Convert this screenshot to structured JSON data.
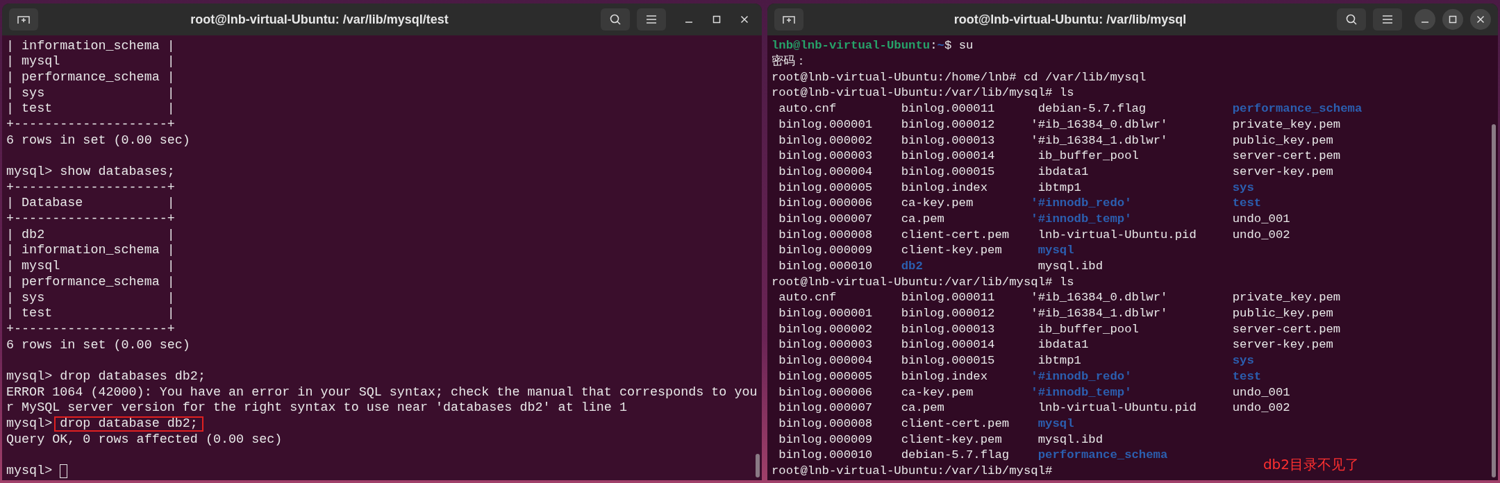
{
  "windows": [
    {
      "title": "root@lnb-virtual-Ubuntu: /var/lib/mysql/test",
      "focused": false,
      "lines": [
        {
          "kind": "text",
          "text": "| information_schema |"
        },
        {
          "kind": "text",
          "text": "| mysql              |"
        },
        {
          "kind": "text",
          "text": "| performance_schema |"
        },
        {
          "kind": "text",
          "text": "| sys                |"
        },
        {
          "kind": "text",
          "text": "| test               |"
        },
        {
          "kind": "text",
          "text": "+--------------------+"
        },
        {
          "kind": "text",
          "text": "6 rows in set (0.00 sec)"
        },
        {
          "kind": "blank"
        },
        {
          "kind": "command",
          "prompt": "mysql>",
          "command": "show databases;",
          "highlighted": false
        },
        {
          "kind": "text",
          "text": "+--------------------+"
        },
        {
          "kind": "text",
          "text": "| Database           |"
        },
        {
          "kind": "text",
          "text": "+--------------------+"
        },
        {
          "kind": "text",
          "text": "| db2                |"
        },
        {
          "kind": "text",
          "text": "| information_schema |"
        },
        {
          "kind": "text",
          "text": "| mysql              |"
        },
        {
          "kind": "text",
          "text": "| performance_schema |"
        },
        {
          "kind": "text",
          "text": "| sys                |"
        },
        {
          "kind": "text",
          "text": "| test               |"
        },
        {
          "kind": "text",
          "text": "+--------------------+"
        },
        {
          "kind": "text",
          "text": "6 rows in set (0.00 sec)"
        },
        {
          "kind": "blank"
        },
        {
          "kind": "command",
          "prompt": "mysql>",
          "command": "drop databases db2;",
          "highlighted": false
        },
        {
          "kind": "text",
          "text": "ERROR 1064 (42000): You have an error in your SQL syntax; check the manual that corresponds to you"
        },
        {
          "kind": "text",
          "text": "r MySQL server version for the right syntax to use near 'databases db2' at line 1"
        },
        {
          "kind": "command",
          "prompt": "mysql>",
          "command": "drop database db2;",
          "highlighted": true
        },
        {
          "kind": "text",
          "text": "Query OK, 0 rows affected (0.00 sec)"
        },
        {
          "kind": "blank"
        },
        {
          "kind": "cursor",
          "prompt": "mysql>"
        }
      ]
    },
    {
      "title": "root@lnb-virtual-Ubuntu: /var/lib/mysql",
      "focused": true,
      "note": "db2目录不见了",
      "lines": [
        {
          "kind": "user_prompt",
          "user": "lnb@lnb-virtual-Ubuntu",
          "sep": ":",
          "path": "~",
          "command": "$ su"
        },
        {
          "kind": "text",
          "text": "密码："
        },
        {
          "kind": "text",
          "text": "root@lnb-virtual-Ubuntu:/home/lnb# cd /var/lib/mysql"
        },
        {
          "kind": "text",
          "text": "root@lnb-virtual-Ubuntu:/var/lib/mysql# ls"
        },
        {
          "kind": "ls",
          "cells": [
            {
              "text": "auto.cnf",
              "kind": "file"
            },
            {
              "text": "binlog.000011",
              "kind": "file"
            },
            {
              "text": "debian-5.7.flag",
              "kind": "file"
            },
            {
              "text": "performance_schema",
              "kind": "dir"
            }
          ]
        },
        {
          "kind": "ls",
          "cells": [
            {
              "text": "binlog.000001",
              "kind": "file"
            },
            {
              "text": "binlog.000012",
              "kind": "file"
            },
            {
              "text": "'#ib_16384_0.dblwr'",
              "kind": "quoted_file"
            },
            {
              "text": "private_key.pem",
              "kind": "file"
            }
          ]
        },
        {
          "kind": "ls",
          "cells": [
            {
              "text": "binlog.000002",
              "kind": "file"
            },
            {
              "text": "binlog.000013",
              "kind": "file"
            },
            {
              "text": "'#ib_16384_1.dblwr'",
              "kind": "quoted_file"
            },
            {
              "text": "public_key.pem",
              "kind": "file"
            }
          ]
        },
        {
          "kind": "ls",
          "cells": [
            {
              "text": "binlog.000003",
              "kind": "file"
            },
            {
              "text": "binlog.000014",
              "kind": "file"
            },
            {
              "text": "ib_buffer_pool",
              "kind": "file"
            },
            {
              "text": "server-cert.pem",
              "kind": "file"
            }
          ]
        },
        {
          "kind": "ls",
          "cells": [
            {
              "text": "binlog.000004",
              "kind": "file"
            },
            {
              "text": "binlog.000015",
              "kind": "file"
            },
            {
              "text": "ibdata1",
              "kind": "file"
            },
            {
              "text": "server-key.pem",
              "kind": "file"
            }
          ]
        },
        {
          "kind": "ls",
          "cells": [
            {
              "text": "binlog.000005",
              "kind": "file"
            },
            {
              "text": "binlog.index",
              "kind": "file"
            },
            {
              "text": "ibtmp1",
              "kind": "file"
            },
            {
              "text": "sys",
              "kind": "dir"
            }
          ]
        },
        {
          "kind": "ls",
          "cells": [
            {
              "text": "binlog.000006",
              "kind": "file"
            },
            {
              "text": "ca-key.pem",
              "kind": "file"
            },
            {
              "text": "'#innodb_redo'",
              "kind": "quoted_dir"
            },
            {
              "text": "test",
              "kind": "dir"
            }
          ]
        },
        {
          "kind": "ls",
          "cells": [
            {
              "text": "binlog.000007",
              "kind": "file"
            },
            {
              "text": "ca.pem",
              "kind": "file"
            },
            {
              "text": "'#innodb_temp'",
              "kind": "quoted_dir"
            },
            {
              "text": "undo_001",
              "kind": "file"
            }
          ]
        },
        {
          "kind": "ls",
          "cells": [
            {
              "text": "binlog.000008",
              "kind": "file"
            },
            {
              "text": "client-cert.pem",
              "kind": "file"
            },
            {
              "text": "lnb-virtual-Ubuntu.pid",
              "kind": "file"
            },
            {
              "text": "undo_002",
              "kind": "file"
            }
          ]
        },
        {
          "kind": "ls",
          "cells": [
            {
              "text": "binlog.000009",
              "kind": "file"
            },
            {
              "text": "client-key.pem",
              "kind": "file"
            },
            {
              "text": "mysql",
              "kind": "dir"
            }
          ]
        },
        {
          "kind": "ls",
          "cells": [
            {
              "text": "binlog.000010",
              "kind": "file"
            },
            {
              "text": "db2",
              "kind": "dir"
            },
            {
              "text": "mysql.ibd",
              "kind": "file"
            }
          ]
        },
        {
          "kind": "text",
          "text": "root@lnb-virtual-Ubuntu:/var/lib/mysql# ls"
        },
        {
          "kind": "ls",
          "cells": [
            {
              "text": "auto.cnf",
              "kind": "file"
            },
            {
              "text": "binlog.000011",
              "kind": "file"
            },
            {
              "text": "'#ib_16384_0.dblwr'",
              "kind": "quoted_file"
            },
            {
              "text": "private_key.pem",
              "kind": "file"
            }
          ]
        },
        {
          "kind": "ls",
          "cells": [
            {
              "text": "binlog.000001",
              "kind": "file"
            },
            {
              "text": "binlog.000012",
              "kind": "file"
            },
            {
              "text": "'#ib_16384_1.dblwr'",
              "kind": "quoted_file"
            },
            {
              "text": "public_key.pem",
              "kind": "file"
            }
          ]
        },
        {
          "kind": "ls",
          "cells": [
            {
              "text": "binlog.000002",
              "kind": "file"
            },
            {
              "text": "binlog.000013",
              "kind": "file"
            },
            {
              "text": "ib_buffer_pool",
              "kind": "file"
            },
            {
              "text": "server-cert.pem",
              "kind": "file"
            }
          ]
        },
        {
          "kind": "ls",
          "cells": [
            {
              "text": "binlog.000003",
              "kind": "file"
            },
            {
              "text": "binlog.000014",
              "kind": "file"
            },
            {
              "text": "ibdata1",
              "kind": "file"
            },
            {
              "text": "server-key.pem",
              "kind": "file"
            }
          ]
        },
        {
          "kind": "ls",
          "cells": [
            {
              "text": "binlog.000004",
              "kind": "file"
            },
            {
              "text": "binlog.000015",
              "kind": "file"
            },
            {
              "text": "ibtmp1",
              "kind": "file"
            },
            {
              "text": "sys",
              "kind": "dir"
            }
          ]
        },
        {
          "kind": "ls",
          "cells": [
            {
              "text": "binlog.000005",
              "kind": "file"
            },
            {
              "text": "binlog.index",
              "kind": "file"
            },
            {
              "text": "'#innodb_redo'",
              "kind": "quoted_dir"
            },
            {
              "text": "test",
              "kind": "dir"
            }
          ]
        },
        {
          "kind": "ls",
          "cells": [
            {
              "text": "binlog.000006",
              "kind": "file"
            },
            {
              "text": "ca-key.pem",
              "kind": "file"
            },
            {
              "text": "'#innodb_temp'",
              "kind": "quoted_dir"
            },
            {
              "text": "undo_001",
              "kind": "file"
            }
          ]
        },
        {
          "kind": "ls",
          "cells": [
            {
              "text": "binlog.000007",
              "kind": "file"
            },
            {
              "text": "ca.pem",
              "kind": "file"
            },
            {
              "text": "lnb-virtual-Ubuntu.pid",
              "kind": "file"
            },
            {
              "text": "undo_002",
              "kind": "file"
            }
          ]
        },
        {
          "kind": "ls",
          "cells": [
            {
              "text": "binlog.000008",
              "kind": "file"
            },
            {
              "text": "client-cert.pem",
              "kind": "file"
            },
            {
              "text": "mysql",
              "kind": "dir"
            }
          ]
        },
        {
          "kind": "ls",
          "cells": [
            {
              "text": "binlog.000009",
              "kind": "file"
            },
            {
              "text": "client-key.pem",
              "kind": "file"
            },
            {
              "text": "mysql.ibd",
              "kind": "file"
            }
          ]
        },
        {
          "kind": "ls",
          "cells": [
            {
              "text": "binlog.000010",
              "kind": "file"
            },
            {
              "text": "debian-5.7.flag",
              "kind": "file"
            },
            {
              "text": "performance_schema",
              "kind": "dir"
            }
          ]
        },
        {
          "kind": "text",
          "text": "root@lnb-virtual-Ubuntu:/var/lib/mysql#"
        }
      ]
    }
  ]
}
